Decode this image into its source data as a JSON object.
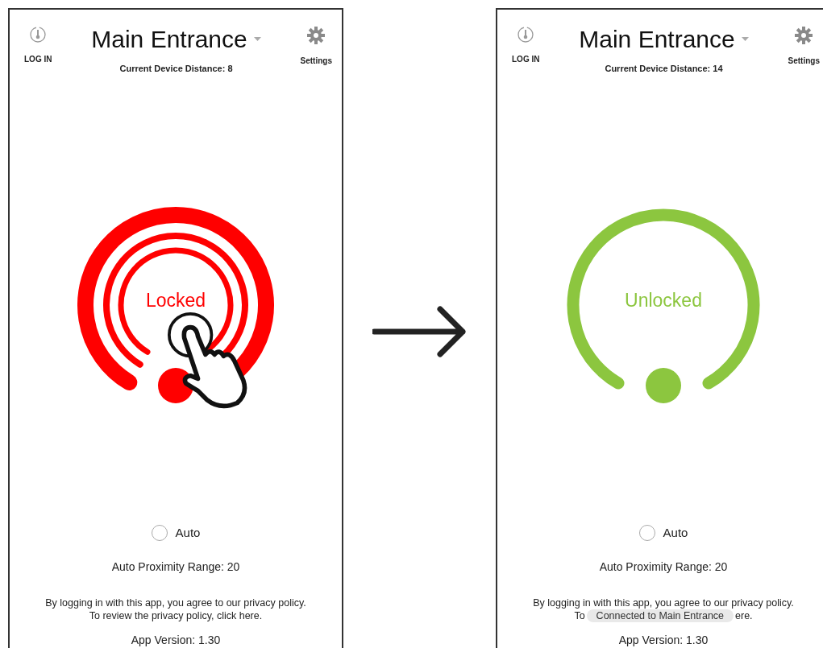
{
  "screens": [
    {
      "login_label": "LOG IN",
      "title": "Main Entrance",
      "distance": "Current Device Distance: 8",
      "settings_label": "Settings",
      "lock": {
        "kind": "locked",
        "status": "Locked"
      },
      "auto": {
        "label": "Auto",
        "checked": false
      },
      "range": "Auto Proximity Range: 20",
      "privacy": [
        "By logging in with this app, you agree to our privacy policy.",
        "To review the privacy policy, click here."
      ],
      "version": "App Version: 1.30"
    },
    {
      "login_label": "LOG IN",
      "title": "Main Entrance",
      "distance": "Current Device Distance: 14",
      "settings_label": "Settings",
      "lock": {
        "kind": "unlocked",
        "status": "Unlocked"
      },
      "auto": {
        "label": "Auto",
        "checked": false
      },
      "range": "Auto Proximity Range: 20",
      "privacy": [
        "By logging in with this app, you agree to our privacy policy."
      ],
      "toast_line": {
        "before": "To",
        "toast": "Connected to Main Entrance",
        "after": "ere."
      },
      "version": "App Version: 1.30"
    }
  ]
}
